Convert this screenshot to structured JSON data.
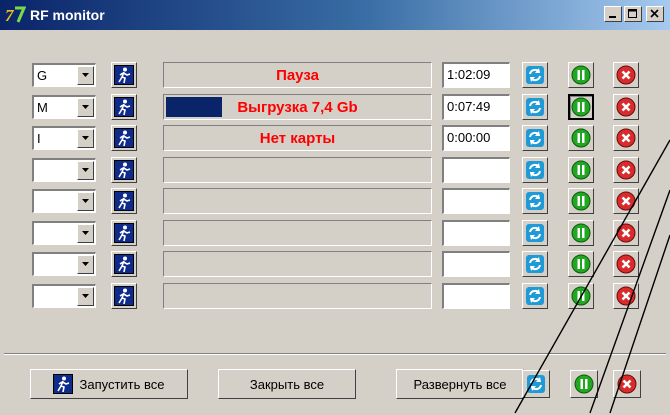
{
  "window": {
    "title": "RF monitor",
    "app_icon": "7-logo-icon"
  },
  "rows": [
    {
      "combo": "G",
      "status": "Пауза",
      "progress": 0,
      "time": "1:02:09",
      "pause_pressed": false
    },
    {
      "combo": "M",
      "status": "Выгрузка  7,4 Gb",
      "progress": 0.21,
      "time": "0:07:49",
      "pause_pressed": true
    },
    {
      "combo": "I",
      "status": "Нет карты",
      "progress": 0,
      "time": "0:00:00",
      "pause_pressed": false
    },
    {
      "combo": "",
      "status": "",
      "progress": 0,
      "time": "",
      "pause_pressed": false
    },
    {
      "combo": "",
      "status": "",
      "progress": 0,
      "time": "",
      "pause_pressed": false
    },
    {
      "combo": "",
      "status": "",
      "progress": 0,
      "time": "",
      "pause_pressed": false
    },
    {
      "combo": "",
      "status": "",
      "progress": 0,
      "time": "",
      "pause_pressed": false
    },
    {
      "combo": "",
      "status": "",
      "progress": 0,
      "time": "",
      "pause_pressed": false
    }
  ],
  "footer": {
    "start_all": "Запустить все",
    "close_all": "Закрыть все",
    "expand_all": "Развернуть все"
  },
  "colors": {
    "status_text": "#ff0000",
    "progress": "#0a246a",
    "refresh": "#1f9ad6",
    "pause": "#22a722",
    "stop": "#d92b2b"
  }
}
